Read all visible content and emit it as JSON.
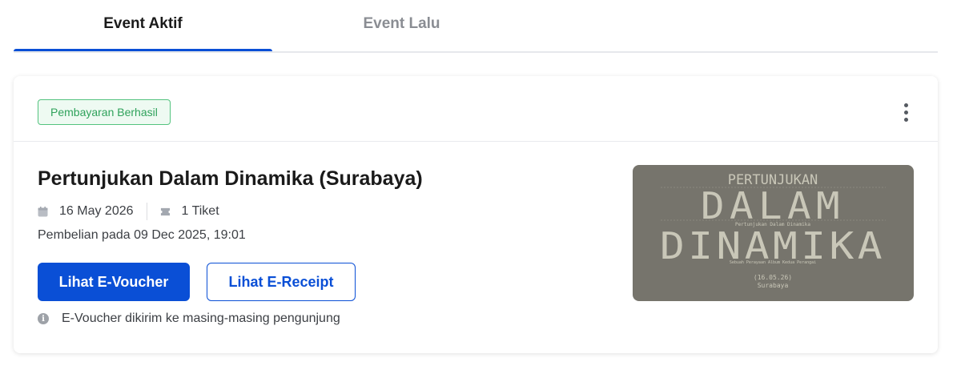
{
  "tabs": [
    {
      "label": "Event Aktif",
      "active": true
    },
    {
      "label": "Event Lalu",
      "active": false
    }
  ],
  "colors": {
    "accent": "#0a4fd6",
    "success": "#2fa25b",
    "muted": "#8a8d93",
    "poster_bg": "#76746c",
    "poster_text": "#c9c7b8"
  },
  "event": {
    "status_badge": "Pembayaran Berhasil",
    "title": "Pertunjukan Dalam Dinamika (Surabaya)",
    "date": "16 May 2026",
    "tickets": "1 Tiket",
    "purchase_info": "Pembelian pada 09 Dec 2025, 19:01",
    "primary_button": "Lihat E-Voucher",
    "secondary_button": "Lihat E-Receipt",
    "note": "E-Voucher dikirim ke masing-masing pengunjung",
    "icons": {
      "date": "calendar-icon",
      "tickets": "ticket-icon",
      "note": "info-icon",
      "menu": "kebab-menu-icon"
    },
    "poster": {
      "top_line": "PERTUNJUKAN",
      "word_1": "DALAM",
      "subtitle": "Pertunjukan Dalam Dinamika",
      "word_2": "DINAMIKA",
      "tagline": "Sebuah Perayaan Album Kedua Perangai",
      "date": "(16.05.26)",
      "city": "Surabaya"
    }
  }
}
